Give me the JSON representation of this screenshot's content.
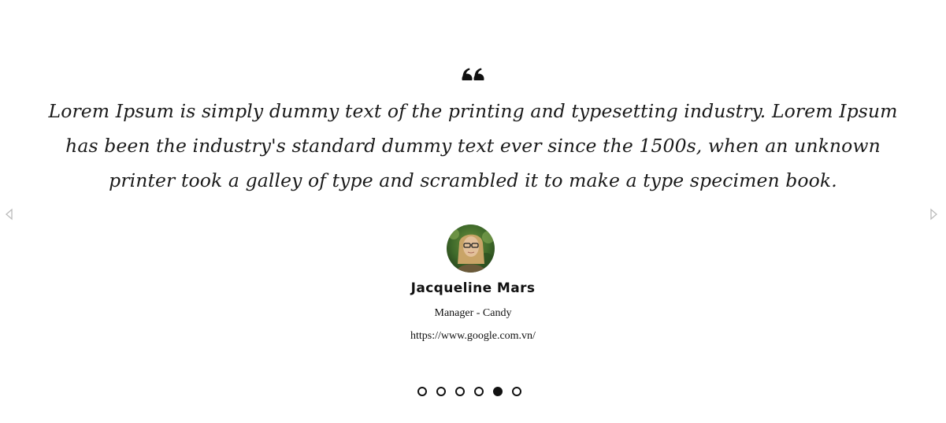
{
  "testimonial": {
    "quote": "Lorem Ipsum is simply dummy text of the printing and typesetting industry. Lorem Ipsum has been the industry's standard dummy text ever since the 1500s, when an unknown printer took a galley of type and scrambled it to make a type specimen book.",
    "author_name": "Jacqueline Mars",
    "author_role": "Manager - Candy",
    "author_url": "https://www.google.com.vn/"
  },
  "icons": {
    "quote": "quote-icon",
    "prev": "arrow-left-icon",
    "next": "arrow-right-icon"
  },
  "pagination": {
    "total": 6,
    "active_index": 4
  },
  "colors": {
    "text": "#111111",
    "arrow": "#bbbbbb",
    "background": "#ffffff"
  }
}
